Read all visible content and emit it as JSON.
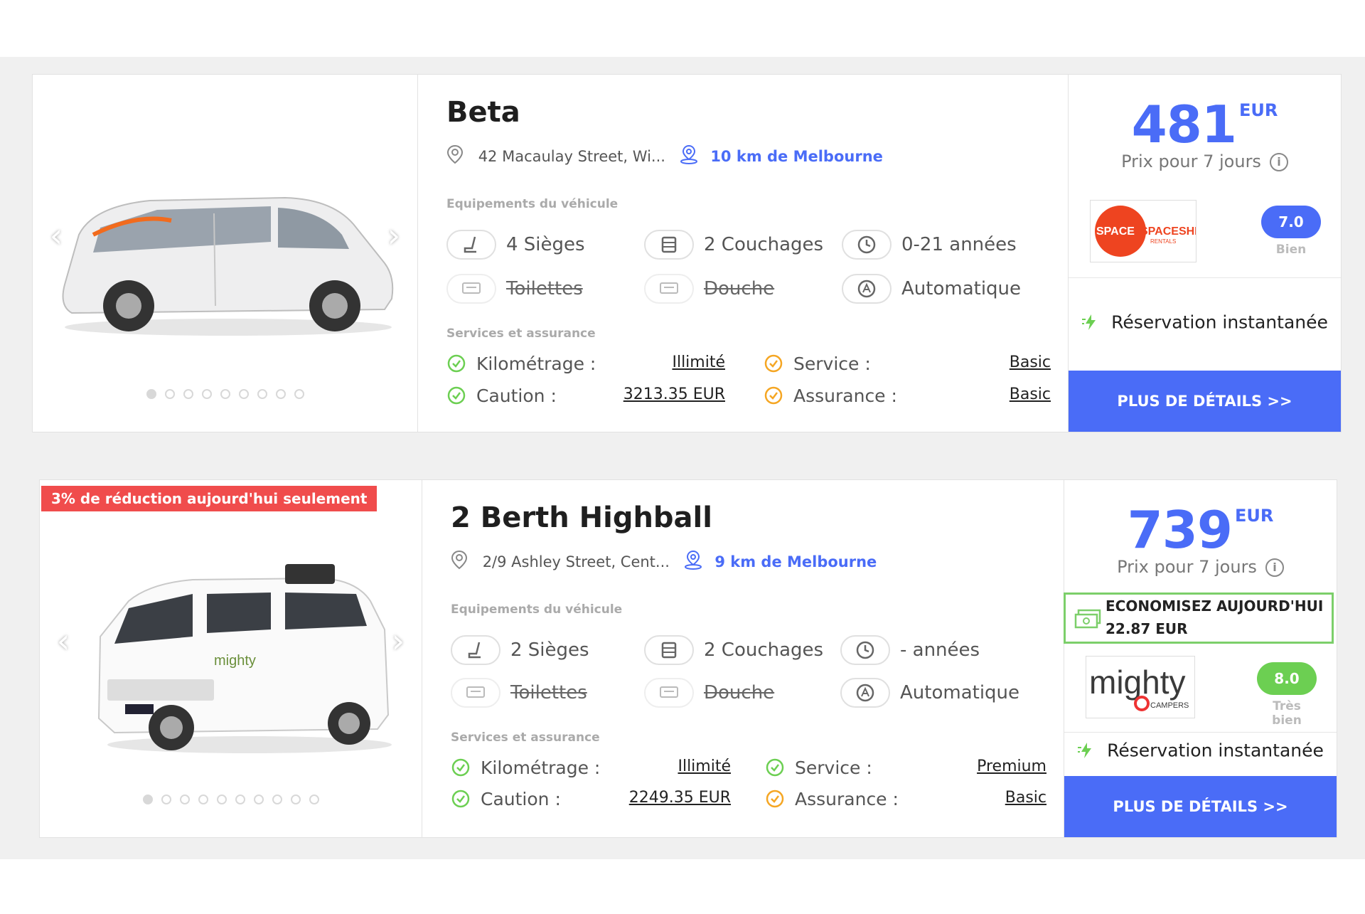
{
  "colors": {
    "accent": "#4a6cf7",
    "promo": "#f04c4c",
    "rating_blue": "#4a6cf7",
    "rating_green": "#6ccf52",
    "savings_border": "#7ccf6a"
  },
  "labels": {
    "equipment_section": "Equipements du véhicule",
    "services_section": "Services et assurance",
    "price_caption": "Prix pour 7 jours",
    "instant_booking": "Réservation instantanée",
    "details_button": "PLUS DE DÉTAILS >>",
    "currency": "EUR"
  },
  "listings": [
    {
      "title": "Beta",
      "address": "42 Macaulay Street, Wi...",
      "distance": "10 km de Melbourne",
      "equipment": {
        "seats": "4 Sièges",
        "beds": "2 Couchages",
        "age": "0-21 années",
        "toilet": "Toilettes",
        "shower": "Douche",
        "transmission": "Automatique"
      },
      "services": {
        "mileage_label": "Kilométrage :",
        "mileage_value": "Illimité",
        "deposit_label": "Caution :",
        "deposit_value": "3213.35 EUR",
        "service_label": "Service :",
        "service_value": "Basic",
        "insurance_label": "Assurance :",
        "insurance_value": "Basic"
      },
      "price": "481",
      "brand_logo": "SPACESHIPS",
      "brand_sub": "RENTALS",
      "rating": "7.0",
      "rating_word": "Bien",
      "carousel_dots": 9
    },
    {
      "promo": "3% de réduction aujourd'hui seulement",
      "title": "2 Berth Highball",
      "address": "2/9 Ashley Street, Cent...",
      "distance": "9 km de Melbourne",
      "equipment": {
        "seats": "2 Sièges",
        "beds": "2 Couchages",
        "age": "- années",
        "toilet": "Toilettes",
        "shower": "Douche",
        "transmission": "Automatique"
      },
      "services": {
        "mileage_label": "Kilométrage :",
        "mileage_value": "Illimité",
        "deposit_label": "Caution :",
        "deposit_value": "2249.35 EUR",
        "service_label": "Service :",
        "service_value": "Premium",
        "insurance_label": "Assurance :",
        "insurance_value": "Basic"
      },
      "price": "739",
      "savings_line1": "ECONOMISEZ AUJOURD'HUI",
      "savings_line2": "22.87 EUR",
      "brand_logo": "mighty",
      "brand_sub": "CAMPERS",
      "rating": "8.0",
      "rating_word": "Très bien",
      "carousel_dots": 10
    }
  ]
}
